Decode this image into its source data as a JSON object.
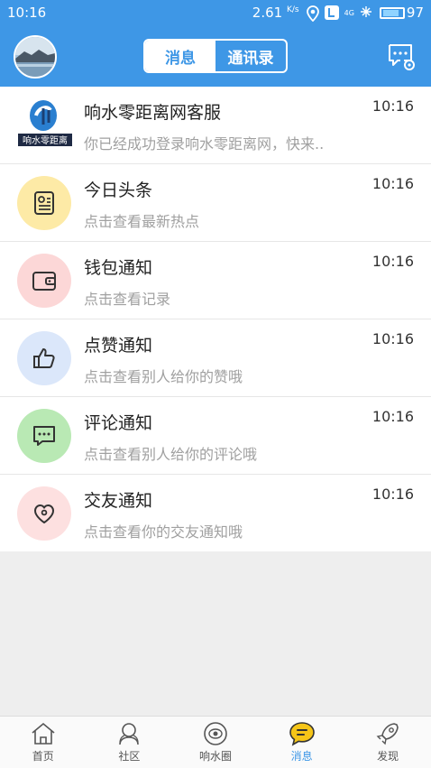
{
  "status_bar": {
    "time": "10:16",
    "speed": "2.61",
    "speed_unit": "K/s",
    "network": "4G",
    "battery": "97"
  },
  "header": {
    "tabs": [
      {
        "label": "消息",
        "active": true
      },
      {
        "label": "通讯录",
        "active": false
      }
    ]
  },
  "colors": {
    "brand": "#3e97e6",
    "toutiao_bg": "#fdeaa6",
    "wallet_bg": "#fcd7d7",
    "like_bg": "#dbe7fa",
    "comment_bg": "#b9e9b4",
    "friend_bg": "#fde0e0"
  },
  "messages": [
    {
      "title": "响水零距离网客服",
      "subtitle": "你已经成功登录响水零距离网，快来..",
      "time": "10:16",
      "icon": "service-logo-icon",
      "logo_text": "响水零距离"
    },
    {
      "title": "今日头条",
      "subtitle": "点击查看最新热点",
      "time": "10:16",
      "icon": "headline-icon"
    },
    {
      "title": "钱包通知",
      "subtitle": "点击查看记录",
      "time": "10:16",
      "icon": "wallet-icon"
    },
    {
      "title": "点赞通知",
      "subtitle": "点击查看别人给你的赞哦",
      "time": "10:16",
      "icon": "thumbs-up-icon"
    },
    {
      "title": "评论通知",
      "subtitle": "点击查看别人给你的评论哦",
      "time": "10:16",
      "icon": "comment-icon"
    },
    {
      "title": "交友通知",
      "subtitle": "点击查看你的交友通知哦",
      "time": "10:16",
      "icon": "heart-icon"
    }
  ],
  "bottom_nav": [
    {
      "label": "首页",
      "icon": "home-icon",
      "active": false
    },
    {
      "label": "社区",
      "icon": "community-icon",
      "active": false
    },
    {
      "label": "响水圈",
      "icon": "circle-icon",
      "active": false
    },
    {
      "label": "消息",
      "icon": "message-icon",
      "active": true
    },
    {
      "label": "发现",
      "icon": "rocket-icon",
      "active": false
    }
  ]
}
